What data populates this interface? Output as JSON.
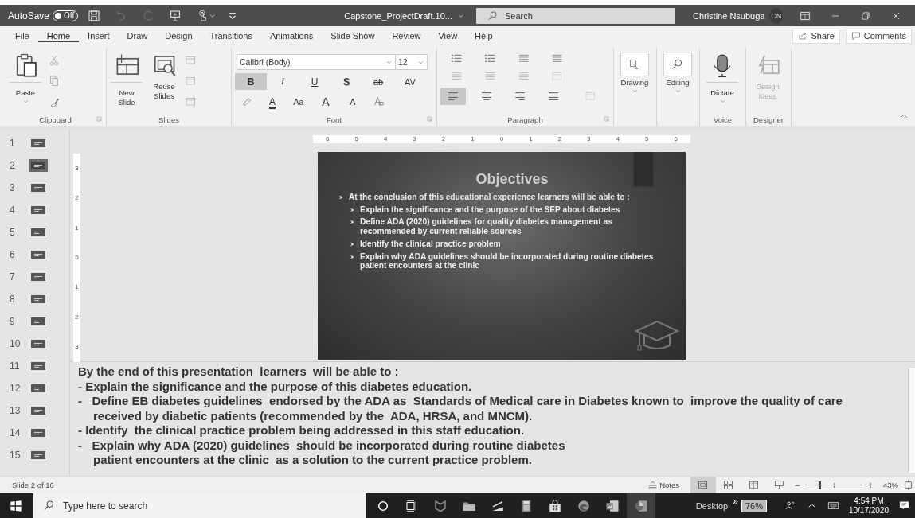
{
  "title_bar": {
    "autosave_label": "AutoSave",
    "autosave_on": false,
    "autosave_state": "Off",
    "file_name": "Capstone_ProjectDraft.10...",
    "search_placeholder": "Search",
    "user_name": "Christine Nsubuga",
    "user_initials": "CN"
  },
  "menu_tabs": [
    {
      "label": "File",
      "selected": false
    },
    {
      "label": "Home",
      "selected": true
    },
    {
      "label": "Insert",
      "selected": false
    },
    {
      "label": "Draw",
      "selected": false
    },
    {
      "label": "Design",
      "selected": false
    },
    {
      "label": "Transitions",
      "selected": false
    },
    {
      "label": "Animations",
      "selected": false
    },
    {
      "label": "Slide Show",
      "selected": false
    },
    {
      "label": "Review",
      "selected": false
    },
    {
      "label": "View",
      "selected": false
    },
    {
      "label": "Help",
      "selected": false
    }
  ],
  "share_label": "Share",
  "comments_label": "Comments",
  "ribbon": {
    "clipboard": {
      "paste_label": "Paste",
      "group_label": "Clipboard"
    },
    "slides": {
      "new_slide_label": "New Slide",
      "reuse_label": "Reuse Slides",
      "group_label": "Slides"
    },
    "font": {
      "font_name": "Calibri (Body)",
      "font_size": "12",
      "group_label": "Font",
      "format_buttons": [
        {
          "label": "B",
          "selected": true
        },
        {
          "label": "I",
          "selected": false
        },
        {
          "label": "U",
          "selected": false
        },
        {
          "label": "S",
          "selected": false
        },
        {
          "label": "ab",
          "selected": false
        },
        {
          "label": "AV",
          "selected": false
        }
      ],
      "size_buttons": [
        {
          "label": "A"
        },
        {
          "label": "Aa"
        },
        {
          "label": "A"
        },
        {
          "label": "A"
        }
      ]
    },
    "paragraph": {
      "group_label": "Paragraph",
      "alignments": [
        {
          "selected": true
        },
        {
          "selected": false
        },
        {
          "selected": false
        },
        {
          "selected": false
        }
      ]
    },
    "drawing_label": "Drawing",
    "editing_label": "Editing",
    "dictate_label": "Dictate",
    "voice_group_label": "Voice",
    "design_ideas_label": "Design Ideas",
    "design_ideas_disabled": true,
    "designer_group_label": "Designer"
  },
  "thumbnails": [
    {
      "number": "1",
      "selected": false
    },
    {
      "number": "2",
      "selected": true
    },
    {
      "number": "3",
      "selected": false
    },
    {
      "number": "4",
      "selected": false
    },
    {
      "number": "5",
      "selected": false
    },
    {
      "number": "6",
      "selected": false
    },
    {
      "number": "7",
      "selected": false
    },
    {
      "number": "8",
      "selected": false
    },
    {
      "number": "9",
      "selected": false
    },
    {
      "number": "10",
      "selected": false
    },
    {
      "number": "11",
      "selected": false
    },
    {
      "number": "12",
      "selected": false
    },
    {
      "number": "13",
      "selected": false
    },
    {
      "number": "14",
      "selected": false
    },
    {
      "number": "15",
      "selected": false
    }
  ],
  "horizontal_ruler": [
    "6",
    "5",
    "4",
    "3",
    "2",
    "1",
    "0",
    "1",
    "2",
    "3",
    "4",
    "5",
    "6"
  ],
  "vertical_ruler": [
    "3",
    "2",
    "1",
    "0",
    "1",
    "2",
    "3"
  ],
  "slide": {
    "title": "Objectives",
    "bullets": [
      {
        "text": "At the conclusion of this educational experience learners will be able to :",
        "children": [
          {
            "text": "Explain the significance and the purpose of the SEP about diabetes"
          },
          {
            "text": "Define ADA (2020) guidelines for quality diabetes management as recommended by current reliable sources"
          },
          {
            "text": "Identify the clinical practice problem"
          },
          {
            "text": "Explain why ADA guidelines should be incorporated during routine diabetes patient encounters at the clinic"
          }
        ]
      }
    ]
  },
  "notes": [
    {
      "text": "By the end of this presentation  learners  will be able to :",
      "continuation": false
    },
    {
      "text": "- Explain the significance and the purpose of this diabetes education.",
      "continuation": false
    },
    {
      "text": "-   Define EB diabetes guidelines  endorsed by the ADA as  Standards of Medical care in Diabetes known to  improve the quality of care",
      "continuation": false
    },
    {
      "text": "received by diabetic patients (recommended by the  ADA, HRSA, and MNCM).",
      "continuation": true
    },
    {
      "text": "- Identify  the clinical practice problem being addressed in this staff education.",
      "continuation": false
    },
    {
      "text": "-   Explain why ADA (2020) guidelines  should be incorporated during routine diabetes",
      "continuation": false
    },
    {
      "text": "patient encounters at the clinic  as a solution to the current practice problem.",
      "continuation": true
    }
  ],
  "status_bar": {
    "slide_counter": "Slide 2 of 16",
    "notes_label": "Notes",
    "views": [
      {
        "selected": true
      },
      {
        "selected": false
      },
      {
        "selected": false
      },
      {
        "selected": false
      }
    ],
    "zoom_minus": "−",
    "zoom_plus": "+",
    "zoom": {
      "level": 0.25
    },
    "zoom_label": "43%"
  },
  "taskbar": {
    "search_placeholder": "Type here to search",
    "desktop_label": "Desktop",
    "chevron": "»",
    "battery_label": "76%",
    "time": "4:54 PM",
    "date": "10/17/2020"
  }
}
